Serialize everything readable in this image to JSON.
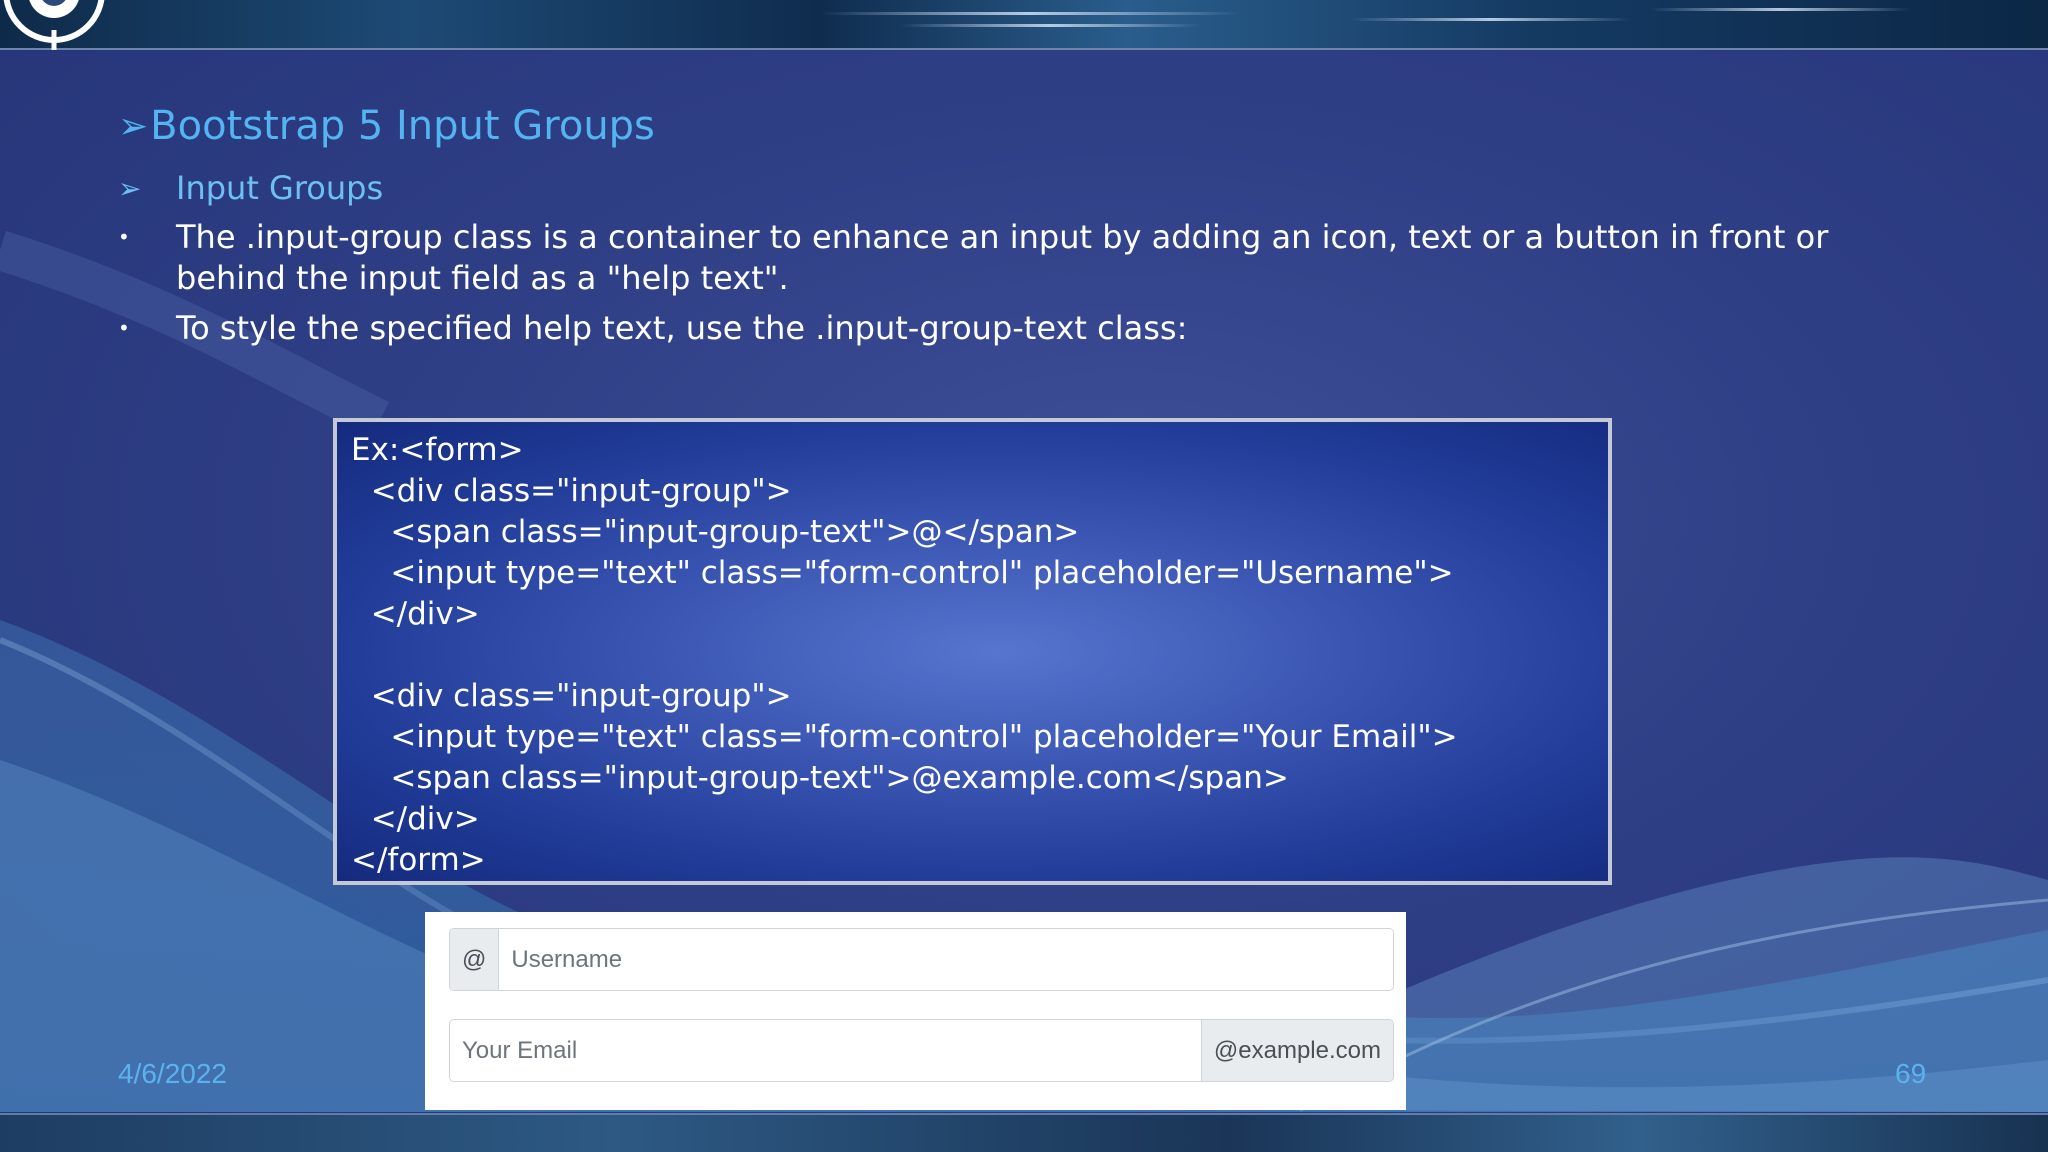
{
  "slide": {
    "title": "Bootstrap 5 Input Groups",
    "title_marker": "➢",
    "bullets": [
      {
        "marker": "➢",
        "text": "Input Groups"
      },
      {
        "marker": "•",
        "text": "The .input-group class is a container to enhance an input by adding an icon, text or a button in front or behind the input field as a \"help text\"."
      },
      {
        "marker": "•",
        "text": "To style the specified help text, use the .input-group-text class:"
      }
    ],
    "code_lines": [
      "Ex:<form>",
      "  <div class=\"input-group\">",
      "    <span class=\"input-group-text\">@</span>",
      "    <input type=\"text\" class=\"form-control\" placeholder=\"Username\">",
      "  </div>",
      "",
      "  <div class=\"input-group\">",
      "    <input type=\"text\" class=\"form-control\" placeholder=\"Your Email\">",
      "    <span class=\"input-group-text\">@example.com</span>",
      "  </div>",
      "</form>"
    ],
    "demo": {
      "username_prefix": "@",
      "username_placeholder": "Username",
      "email_placeholder": "Your Email",
      "email_suffix": "@example.com"
    },
    "footer": {
      "date": "4/6/2022",
      "page_number": "69"
    }
  },
  "colors": {
    "title": "#53b4f0",
    "background": "#2f3f86",
    "code_box": "#3c58b4",
    "footer_text": "#5cb2ee"
  }
}
